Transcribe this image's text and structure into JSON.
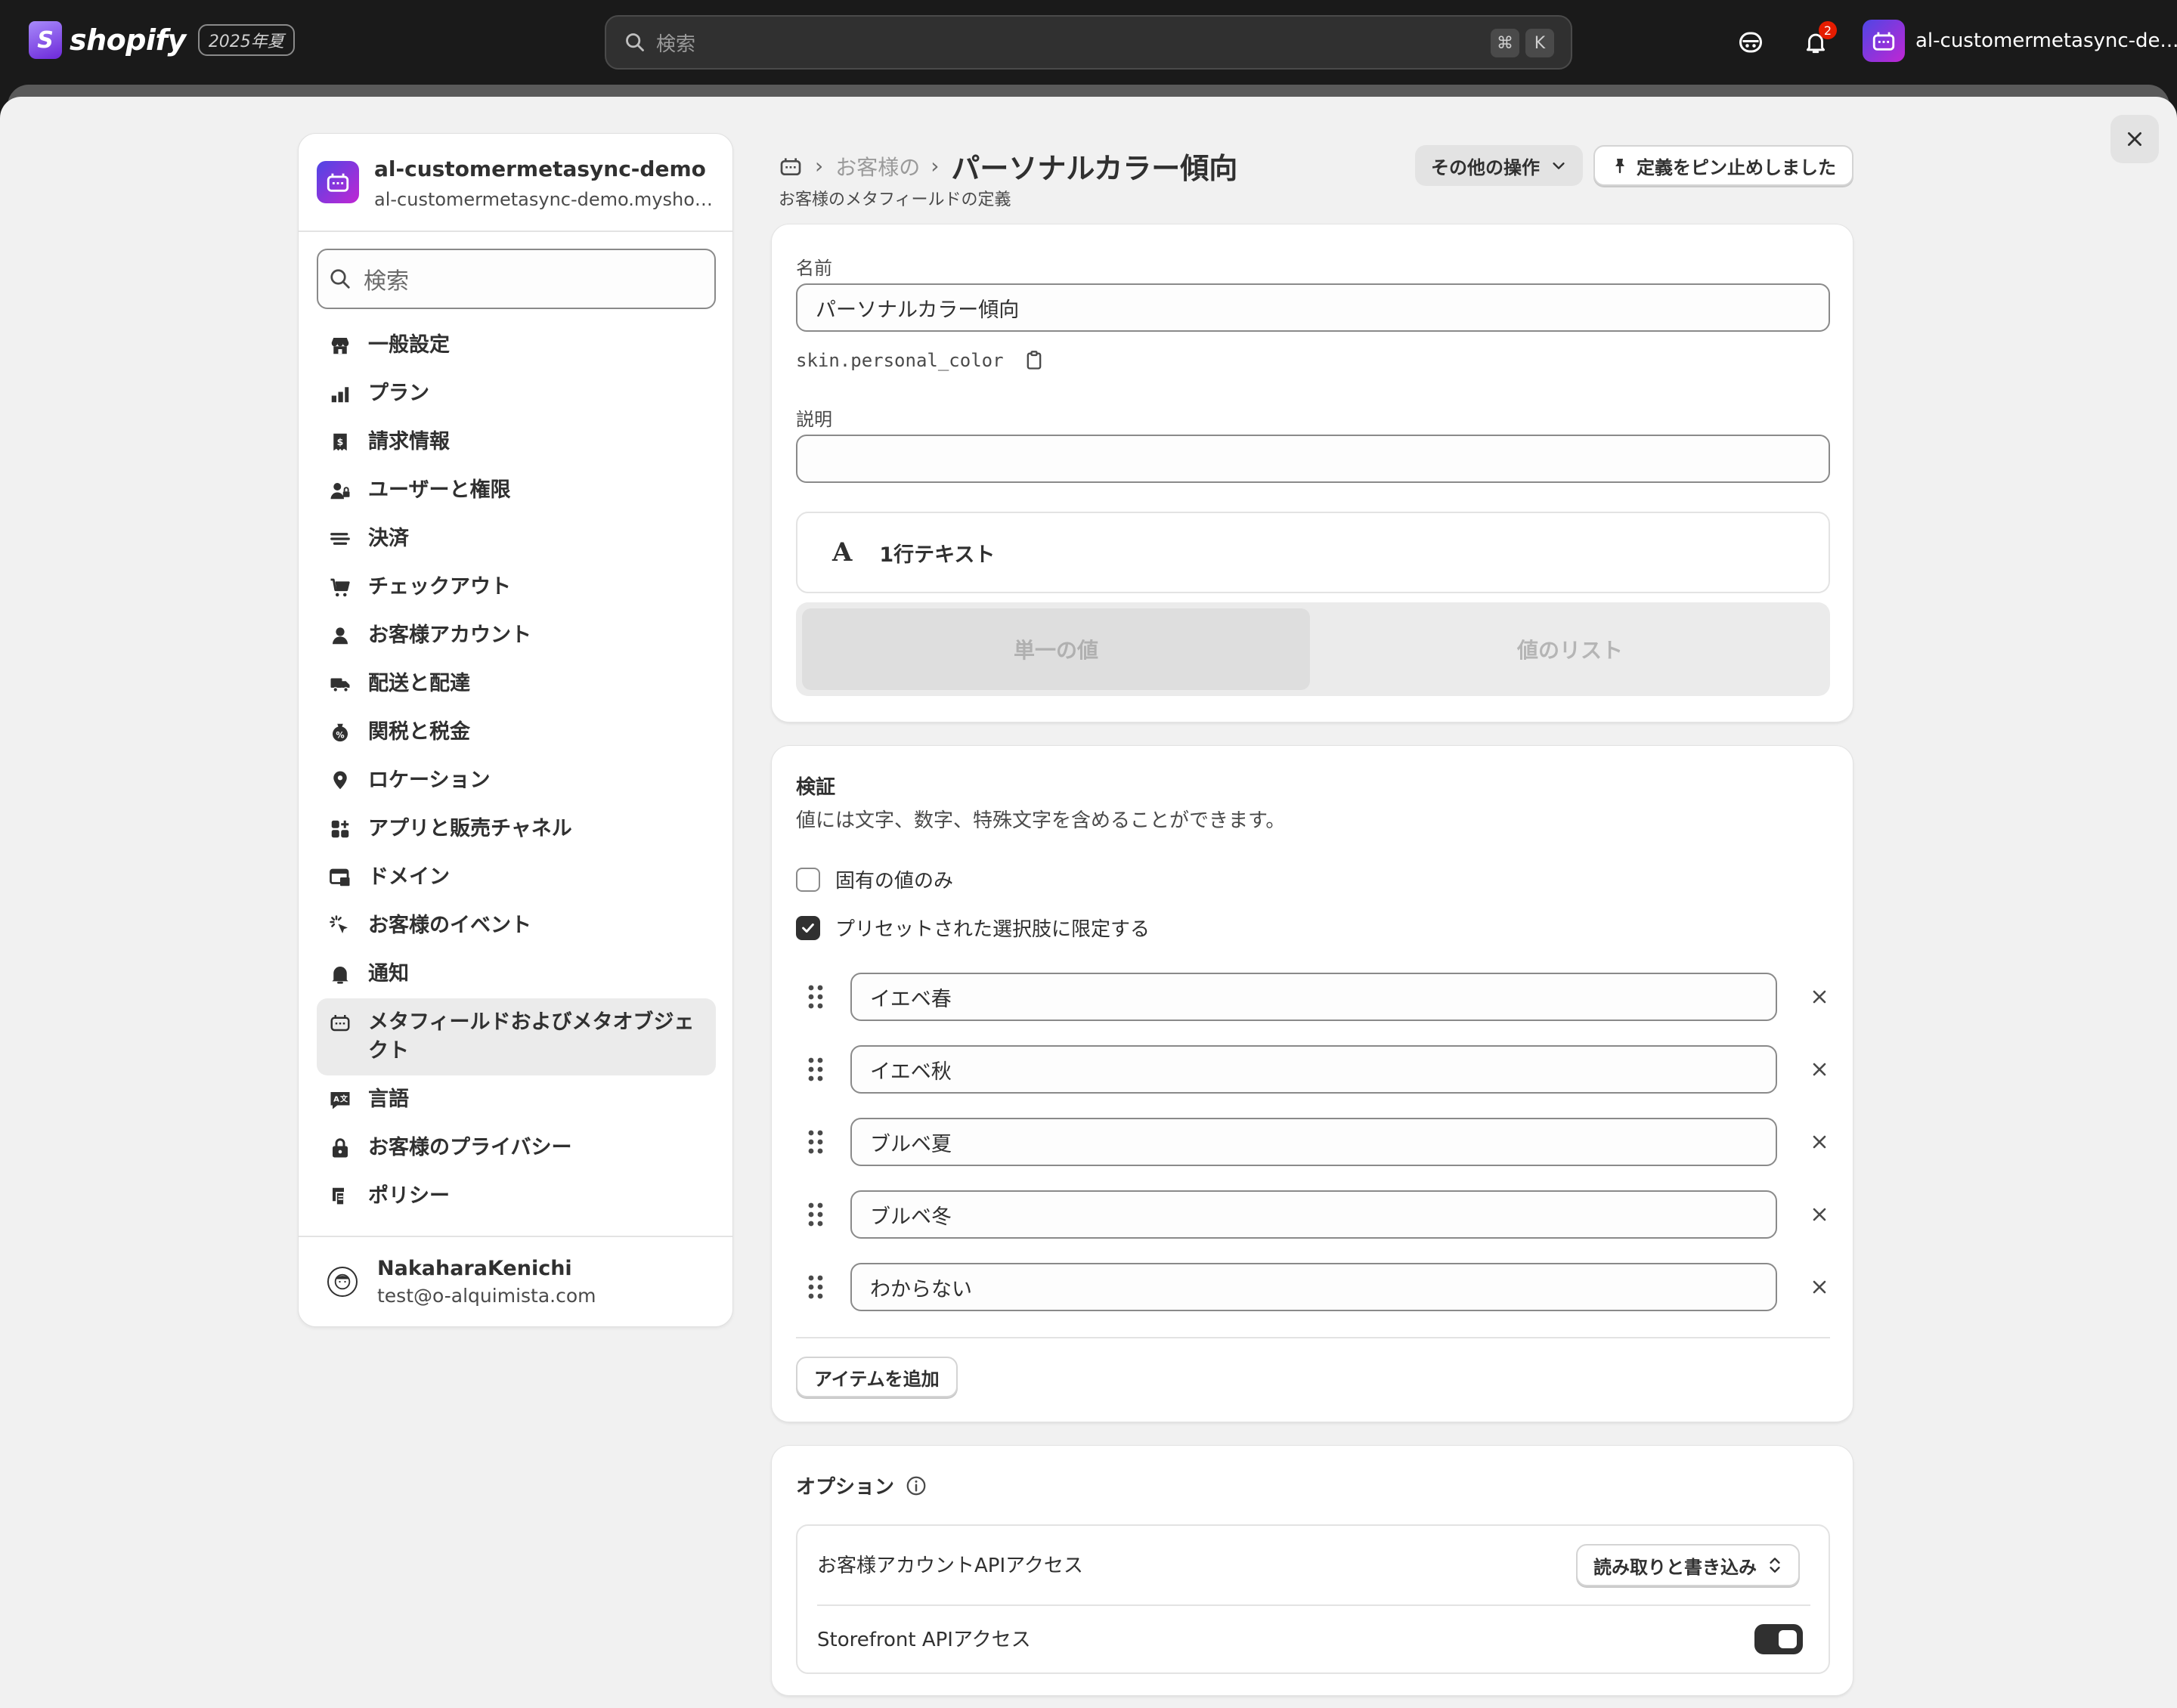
{
  "topbar": {
    "brand": "shopify",
    "brand_badge": "2025年夏",
    "search_placeholder": "検索",
    "shortcut_keys": [
      "⌘",
      "K"
    ],
    "notification_count": "2",
    "store_name": "al-customermetasync-de..."
  },
  "sidebar": {
    "store_name": "al-customermetasync-demo",
    "store_domain": "al-customermetasync-demo.myshopi...",
    "search_placeholder": "検索",
    "items": [
      {
        "label": "一般設定",
        "icon": "store-icon"
      },
      {
        "label": "プラン",
        "icon": "plan-icon"
      },
      {
        "label": "請求情報",
        "icon": "billing-icon"
      },
      {
        "label": "ユーザーと権限",
        "icon": "users-icon"
      },
      {
        "label": "決済",
        "icon": "payments-icon"
      },
      {
        "label": "チェックアウト",
        "icon": "cart-icon"
      },
      {
        "label": "お客様アカウント",
        "icon": "person-icon"
      },
      {
        "label": "配送と配達",
        "icon": "truck-icon"
      },
      {
        "label": "関税と税金",
        "icon": "tax-icon"
      },
      {
        "label": "ロケーション",
        "icon": "location-icon"
      },
      {
        "label": "アプリと販売チャネル",
        "icon": "apps-icon"
      },
      {
        "label": "ドメイン",
        "icon": "domain-icon"
      },
      {
        "label": "お客様のイベント",
        "icon": "events-icon"
      },
      {
        "label": "通知",
        "icon": "bell-icon"
      },
      {
        "label": "メタフィールドおよびメタオブジェクト",
        "icon": "metafields-icon",
        "active": true
      },
      {
        "label": "言語",
        "icon": "language-icon"
      },
      {
        "label": "お客様のプライバシー",
        "icon": "lock-icon"
      },
      {
        "label": "ポリシー",
        "icon": "policy-icon"
      }
    ],
    "user": {
      "name": "NakaharaKenichi",
      "email": "test@o-alquimista.com"
    }
  },
  "header": {
    "breadcrumb_prev": "お客様の",
    "title": "パーソナルカラー傾向",
    "subtitle": "お客様のメタフィールドの定義",
    "more_actions": "その他の操作",
    "pin_label": "定義をピン止めしました"
  },
  "definition": {
    "name_label": "名前",
    "name_value": "パーソナルカラー傾向",
    "namespace_key": "skin.personal_color",
    "description_label": "説明",
    "description_value": "",
    "type_glyph": "A",
    "type_label": "1行テキスト",
    "value_modes": [
      "単一の値",
      "値のリスト"
    ],
    "selected_mode": "単一の値"
  },
  "validation": {
    "title": "検証",
    "description": "値には文字、数字、特殊文字を含めることができます。",
    "unique_only_label": "固有の値のみ",
    "unique_only_checked": false,
    "preset_limit_label": "プリセットされた選択肢に限定する",
    "preset_limit_checked": true,
    "choices": [
      "イエベ春",
      "イエベ秋",
      "ブルベ夏",
      "ブルベ冬",
      "わからない"
    ],
    "add_item_label": "アイテムを追加"
  },
  "options": {
    "title": "オプション",
    "customer_api_label": "お客様アカウントAPIアクセス",
    "customer_api_value": "読み取りと書き込み",
    "storefront_api_label": "Storefront APIアクセス",
    "storefront_api_enabled": true
  },
  "colors": {
    "topbar": "#1a1a1a",
    "background": "#f1f1f1",
    "card": "#ffffff",
    "text": "#303030",
    "active_nav": "#ebebeb",
    "notification_badge": "#e51c00"
  }
}
